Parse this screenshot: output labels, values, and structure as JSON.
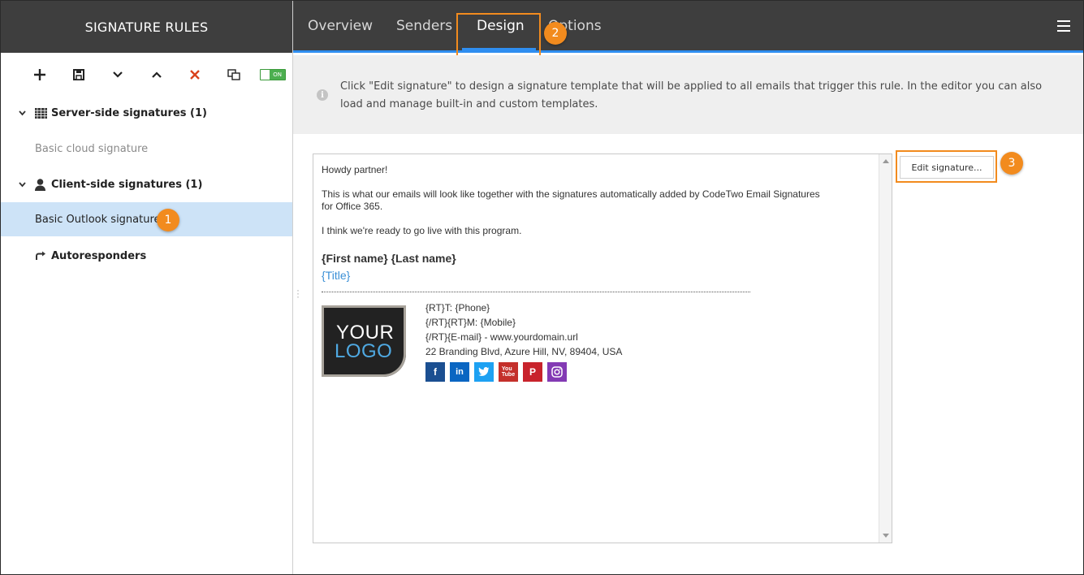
{
  "app": {
    "sidebar_title": "SIGNATURE RULES"
  },
  "toolbar": {
    "icons": [
      "add-icon",
      "save-icon",
      "move-down-icon",
      "move-up-icon",
      "delete-icon",
      "duplicate-icon"
    ],
    "toggle_label": "ON",
    "accent_colors": {
      "delete": "#d9421c",
      "toggle": "#4caf50"
    }
  },
  "tree": {
    "server_group": "Server-side signatures (1)",
    "server_items": [
      "Basic cloud signature"
    ],
    "client_group": "Client-side signatures (1)",
    "client_items": [
      "Basic Outlook signature"
    ],
    "autoresponders": "Autoresponders"
  },
  "tabs": [
    "Overview",
    "Senders",
    "Design",
    "Options"
  ],
  "active_tab": "Design",
  "info_text": "Click \"Edit signature\" to design a signature template that will be applied to all emails that trigger this rule. In the editor you can also load and manage built-in and custom templates.",
  "preview": {
    "greeting": "Howdy partner!",
    "body1": "This is what our emails will look like together with the signatures automatically added by CodeTwo Email Signatures for Office 365.",
    "body2": "I think we're ready to go live with this program.",
    "name": "{First name} {Last name}",
    "title": "{Title}",
    "logo_line1": "YOUR",
    "logo_line2": "LOGO",
    "phone": "{RT}T: {Phone}",
    "mobile": "{/RT}{RT}M: {Mobile}",
    "email": "{/RT}{E-mail} - www.yourdomain.url",
    "address": "22 Branding Blvd, Azure Hill, NV, 89404, USA",
    "social": [
      {
        "icon": "facebook-icon",
        "glyph": "f",
        "color": "#1b4f91"
      },
      {
        "icon": "linkedin-icon",
        "glyph": "in",
        "color": "#0a66c2"
      },
      {
        "icon": "twitter-icon",
        "glyph": "🐦",
        "color": "#1da1f2"
      },
      {
        "icon": "youtube-icon",
        "glyph": "▶",
        "color": "#c4302b"
      },
      {
        "icon": "pinterest-icon",
        "glyph": "P",
        "color": "#c8232c"
      },
      {
        "icon": "instagram-icon",
        "glyph": "◎",
        "color": "#833ab4"
      }
    ]
  },
  "edit_button": "Edit signature...",
  "annotations": [
    "1",
    "2",
    "3"
  ],
  "colors": {
    "accent": "#2f8ef0",
    "highlight": "#f28b1e",
    "selected_row": "#cde3f7",
    "header": "#3e3e3e"
  }
}
